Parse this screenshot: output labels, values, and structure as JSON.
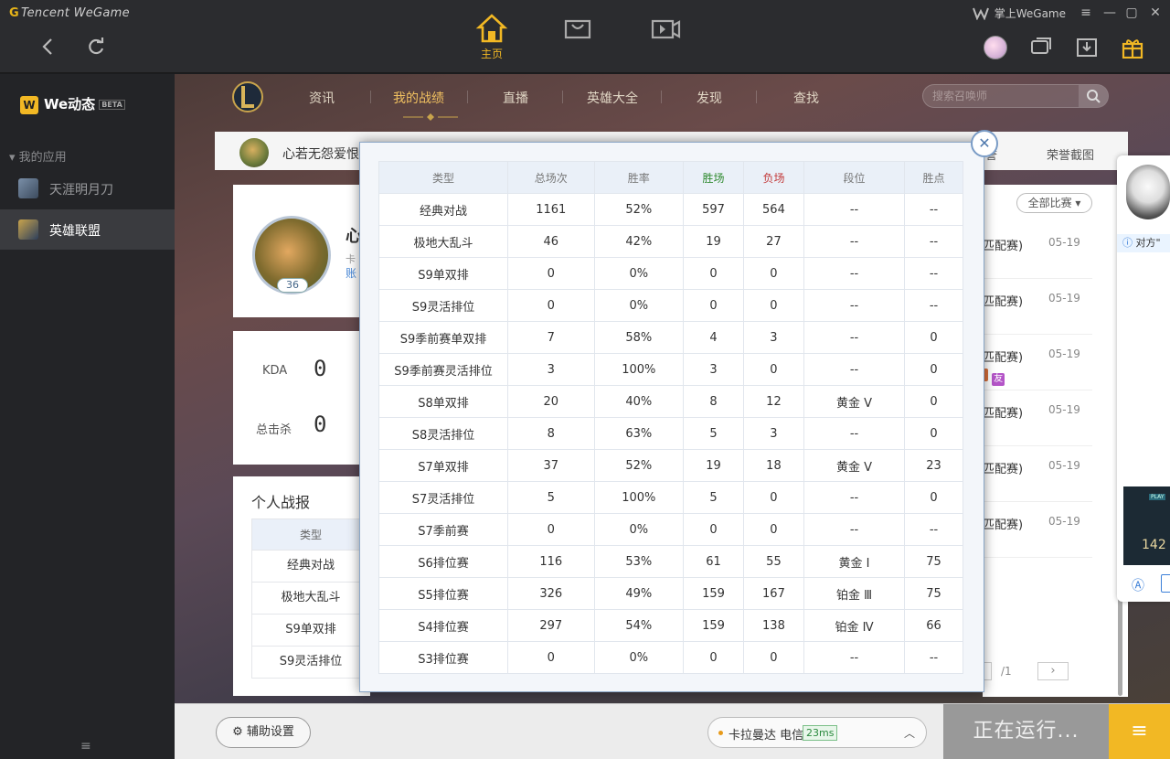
{
  "window": {
    "brand": "Tencent WeGame",
    "mobile_link": "掌上WeGame",
    "home_tab": "主页"
  },
  "sidebar": {
    "we_title": "We动态",
    "beta": "BETA",
    "apps_title": "我的应用",
    "items": [
      {
        "label": "天涯明月刀"
      },
      {
        "label": "英雄联盟"
      }
    ]
  },
  "lol": {
    "tabs": [
      "资讯",
      "我的战绩",
      "直播",
      "英雄大全",
      "发现",
      "查找"
    ],
    "active_tab": "我的战绩",
    "search_placeholder": "搜索召唤师"
  },
  "profile": {
    "name_short": "心若无怨爱恨",
    "card_name": "心",
    "card_sub": "卡",
    "card_link": "账",
    "level": "36",
    "right_links": [
      "誉",
      "荣誉截图"
    ]
  },
  "stats_card": {
    "kda_label": "KDA",
    "kda_value": "0",
    "kills_label": "总击杀",
    "kills_value": "0"
  },
  "report": {
    "title": "个人战报",
    "header": "类型",
    "rows": [
      "经典对战",
      "极地大乱斗",
      "S9单双排",
      "S9灵活排位"
    ]
  },
  "match_list": {
    "filter": "全部比赛",
    "rows": [
      {
        "type": "匹配赛)",
        "date": "05-19"
      },
      {
        "type": "匹配赛)",
        "date": "05-19"
      },
      {
        "type": "匹配赛)",
        "date": "05-19"
      },
      {
        "type": "匹配赛)",
        "date": "05-19"
      },
      {
        "type": "匹配赛)",
        "date": "05-19"
      },
      {
        "type": "匹配赛)",
        "date": "05-19"
      }
    ],
    "tag_friend": "友",
    "page_total": "/1"
  },
  "modal_table": {
    "headers": [
      "类型",
      "总场次",
      "胜率",
      "胜场",
      "负场",
      "段位",
      "胜点"
    ],
    "rows": [
      [
        "经典对战",
        "1161",
        "52%",
        "597",
        "564",
        "--",
        "--"
      ],
      [
        "极地大乱斗",
        "46",
        "42%",
        "19",
        "27",
        "--",
        "--"
      ],
      [
        "S9单双排",
        "0",
        "0%",
        "0",
        "0",
        "--",
        "--"
      ],
      [
        "S9灵活排位",
        "0",
        "0%",
        "0",
        "0",
        "--",
        "--"
      ],
      [
        "S9季前赛单双排",
        "7",
        "58%",
        "4",
        "3",
        "--",
        "0"
      ],
      [
        "S9季前赛灵活排位",
        "3",
        "100%",
        "3",
        "0",
        "--",
        "0"
      ],
      [
        "S8单双排",
        "20",
        "40%",
        "8",
        "12",
        "黄金 V",
        "0"
      ],
      [
        "S8灵活排位",
        "8",
        "63%",
        "5",
        "3",
        "--",
        "0"
      ],
      [
        "S7单双排",
        "37",
        "52%",
        "19",
        "18",
        "黄金 V",
        "23"
      ],
      [
        "S7灵活排位",
        "5",
        "100%",
        "5",
        "0",
        "--",
        "0"
      ],
      [
        "S7季前赛",
        "0",
        "0%",
        "0",
        "0",
        "--",
        "--"
      ],
      [
        "S6排位赛",
        "116",
        "53%",
        "61",
        "55",
        "黄金 Ⅰ",
        "75"
      ],
      [
        "S5排位赛",
        "326",
        "49%",
        "159",
        "167",
        "铂金 Ⅲ",
        "75"
      ],
      [
        "S4排位赛",
        "297",
        "54%",
        "159",
        "138",
        "铂金 Ⅳ",
        "66"
      ],
      [
        "S3排位赛",
        "0",
        "0%",
        "0",
        "0",
        "--",
        "--"
      ]
    ]
  },
  "chat_panel": {
    "notice": "对方\"",
    "thumb_number": "142",
    "thumb_label": "PLAY"
  },
  "bottom": {
    "assist": "辅助设置",
    "server": "卡拉曼达 电信",
    "ping": "23ms",
    "running": "正在运行..."
  },
  "colors": {
    "accent": "#f2b824",
    "win": "#2f8a2f",
    "loss": "#c33a3a"
  }
}
